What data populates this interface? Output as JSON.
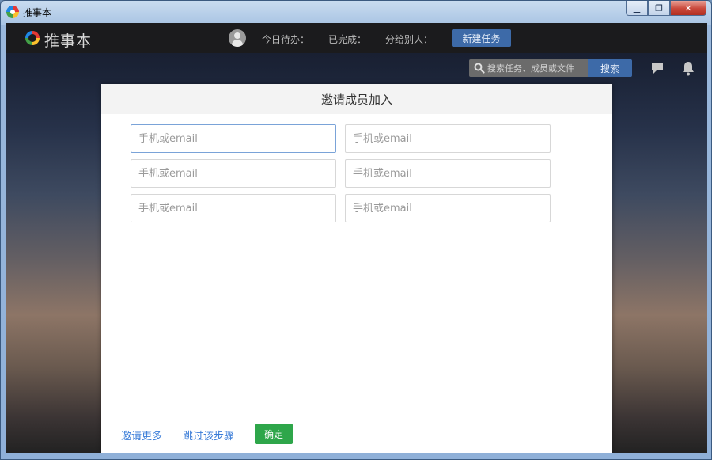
{
  "window": {
    "title": "推事本",
    "minimize_glyph": "▁",
    "restore_glyph": "❐",
    "close_glyph": "✕"
  },
  "topbar": {
    "logo_text": "推事本",
    "stats": {
      "today_todo": "今日待办：",
      "completed": "已完成：",
      "assigned_others": "分给别人："
    },
    "new_task_label": "新建任务"
  },
  "search": {
    "placeholder": "搜索任务、成员或文件",
    "button_label": "搜索"
  },
  "icons": {
    "search": "search-icon",
    "chat": "chat-icon",
    "bell": "bell-icon",
    "avatar": "avatar"
  },
  "dialog": {
    "title": "邀请成员加入",
    "fields": [
      {
        "placeholder": "手机或email"
      },
      {
        "placeholder": "手机或email"
      },
      {
        "placeholder": "手机或email"
      },
      {
        "placeholder": "手机或email"
      },
      {
        "placeholder": "手机或email"
      },
      {
        "placeholder": "手机或email"
      }
    ],
    "invite_more_label": "邀请更多",
    "skip_label": "跳过该步骤",
    "confirm_label": "确定"
  },
  "colors": {
    "accent_blue": "#3d6aa8",
    "link_blue": "#3b7dd8",
    "confirm_green": "#2ea64a"
  }
}
